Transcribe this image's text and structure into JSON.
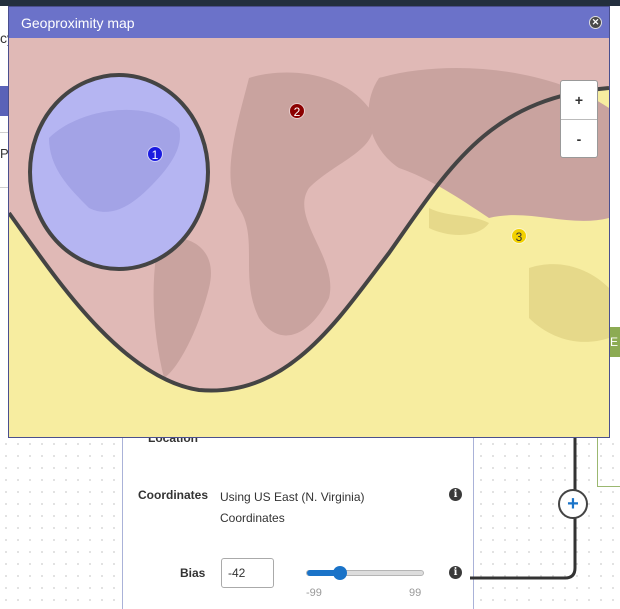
{
  "background": {
    "left_text": "cy",
    "left_input_prefix": "P",
    "right_tab_letter": "E",
    "location_label": "Location",
    "coordinates_label": "Coordinates",
    "coordinates_value": "Using US East (N. Virginia) Coordinates",
    "bias_label": "Bias",
    "bias_value": "-42",
    "bias_min": "-99",
    "bias_max": "99",
    "bias_level": -42,
    "add_button": "+"
  },
  "modal": {
    "title": "Geoproximity map",
    "close_icon": "close-icon",
    "zoom_in": "+",
    "zoom_out": "-"
  },
  "markers": [
    {
      "label": "1",
      "color": "#1a1ae0",
      "text_color": "#ffffff"
    },
    {
      "label": "2",
      "color": "#8b0000",
      "text_color": "#ffffff"
    },
    {
      "label": "3",
      "color": "#f2d100",
      "text_color": "#333333"
    }
  ],
  "colors": {
    "region_1": "#b5b5f2",
    "region_2": "#e0b9b6",
    "region_3": "#f7eda0",
    "boundary": "#444444",
    "header": "#6b72c9"
  }
}
